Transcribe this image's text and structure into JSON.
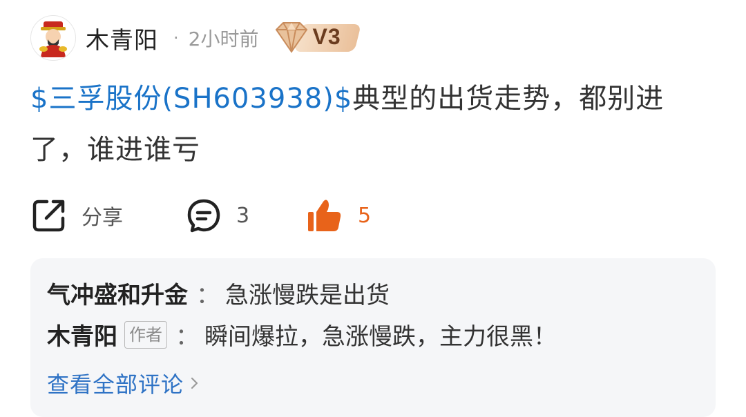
{
  "post": {
    "username": "木青阳",
    "separator": "·",
    "time": "2小时前",
    "level_badge": "V3",
    "stock_tag": "$三孚股份(SH603938)$",
    "text": "典型的出货走势，都别进了，谁进谁亏"
  },
  "actions": {
    "share_label": "分享",
    "comment_count": "3",
    "like_count": "5"
  },
  "comments": [
    {
      "author": "气冲盛和升金",
      "sep": "：",
      "text": "急涨慢跌是出货"
    },
    {
      "author": "木青阳",
      "tag": "作者",
      "sep": "：",
      "text": "瞬间爆拉，急涨慢跌，主力很黑！"
    }
  ],
  "view_all_label": "查看全部评论",
  "colors": {
    "link": "#1a73c8",
    "like": "#e8631a",
    "comment_bg": "#f5f6f8"
  }
}
